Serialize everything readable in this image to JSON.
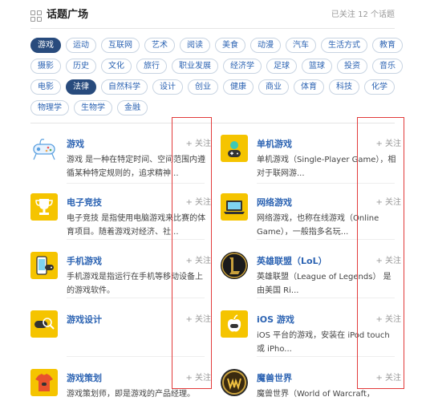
{
  "header": {
    "title": "话题广场",
    "followed_text": "已关注 12 个话题"
  },
  "tags": {
    "rows": [
      [
        {
          "label": "游戏",
          "active": true
        },
        {
          "label": "运动",
          "active": false
        },
        {
          "label": "互联网",
          "active": false
        },
        {
          "label": "艺术",
          "active": false
        },
        {
          "label": "阅读",
          "active": false
        },
        {
          "label": "美食",
          "active": false
        },
        {
          "label": "动漫",
          "active": false
        },
        {
          "label": "汽车",
          "active": false
        },
        {
          "label": "生活方式",
          "active": false
        },
        {
          "label": "教育",
          "active": false
        }
      ],
      [
        {
          "label": "摄影",
          "active": false
        },
        {
          "label": "历史",
          "active": false
        },
        {
          "label": "文化",
          "active": false
        },
        {
          "label": "旅行",
          "active": false
        },
        {
          "label": "职业发展",
          "active": false
        },
        {
          "label": "经济学",
          "active": false
        },
        {
          "label": "足球",
          "active": false
        },
        {
          "label": "篮球",
          "active": false
        },
        {
          "label": "投资",
          "active": false
        },
        {
          "label": "音乐",
          "active": false
        }
      ],
      [
        {
          "label": "电影",
          "active": false
        },
        {
          "label": "法律",
          "active": true
        },
        {
          "label": "自然科学",
          "active": false
        },
        {
          "label": "设计",
          "active": false
        },
        {
          "label": "创业",
          "active": false
        },
        {
          "label": "健康",
          "active": false
        },
        {
          "label": "商业",
          "active": false
        },
        {
          "label": "体育",
          "active": false
        },
        {
          "label": "科技",
          "active": false
        },
        {
          "label": "化学",
          "active": false
        }
      ],
      [
        {
          "label": "物理学",
          "active": false
        },
        {
          "label": "生物学",
          "active": false
        },
        {
          "label": "金融",
          "active": false
        }
      ]
    ]
  },
  "topics": [
    {
      "name": "游戏",
      "desc": "游戏 是一种在特定时间、空间范围内遵循某种特定规则的，追求精神...",
      "follow": "+ 关注",
      "icon": "gamepad-icon"
    },
    {
      "name": "单机游戏",
      "desc": "单机游戏（Single-Player Game），相对于联网游...",
      "follow": "+ 关注",
      "icon": "single-player-game-icon"
    },
    {
      "name": "电子竞技",
      "desc": "电子竞技 是指使用电脑游戏来比赛的体育项目。随着游戏对经济、社...",
      "follow": "+ 关注",
      "icon": "trophy-icon"
    },
    {
      "name": "网络游戏",
      "desc": "网络游戏，也称在线游戏（Online Game），一般指多名玩...",
      "follow": "+ 关注",
      "icon": "laptop-game-icon"
    },
    {
      "name": "手机游戏",
      "desc": "手机游戏是指运行在手机等移动设备上的游戏软件。",
      "follow": "+ 关注",
      "icon": "mobile-game-icon"
    },
    {
      "name": "英雄联盟（LoL）",
      "desc": "英雄联盟（League of Legends） 是由美国 Ri...",
      "follow": "+ 关注",
      "icon": "lol-logo-icon"
    },
    {
      "name": "游戏设计",
      "desc": "",
      "follow": "+ 关注",
      "icon": "game-design-icon"
    },
    {
      "name": "iOS 游戏",
      "desc": "iOS 平台的游戏，安装在 iPod touch 或 iPho...",
      "follow": "+ 关注",
      "icon": "apple-game-icon"
    },
    {
      "name": "游戏策划",
      "desc": "游戏策划师，即是游戏的产品经理。",
      "follow": "+ 关注",
      "icon": "tshirt-icon"
    },
    {
      "name": "魔兽世界",
      "desc": "魔兽世界（World of Warcraft，WoW）是...",
      "follow": "+ 关注",
      "icon": "wow-logo-icon"
    }
  ],
  "colors": {
    "tag_active_bg": "#284b7d",
    "link_blue": "#2d64b3",
    "icon_yellow": "#f5c400",
    "annotation_red": "#e23b3b"
  }
}
